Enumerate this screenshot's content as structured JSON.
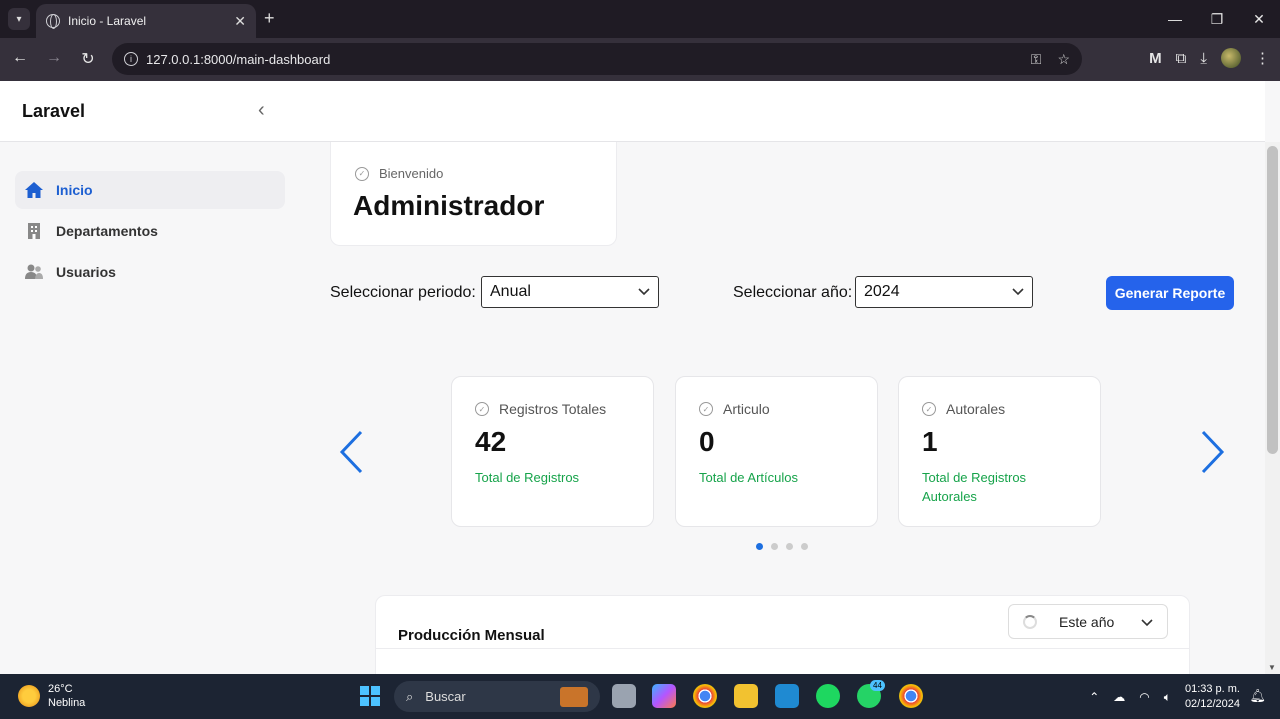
{
  "browser": {
    "tab_title": "Inicio - Laravel",
    "url": "127.0.0.1:8000/main-dashboard"
  },
  "app": {
    "brand": "Laravel",
    "sidebar": {
      "items": [
        {
          "label": "Inicio",
          "icon": "home-icon",
          "active": true
        },
        {
          "label": "Departamentos",
          "icon": "building-icon",
          "active": false
        },
        {
          "label": "Usuarios",
          "icon": "users-icon",
          "active": false
        }
      ]
    },
    "welcome": {
      "label": "Bienvenido",
      "name": "Administrador"
    },
    "filters": {
      "period_label": "Seleccionar periodo:",
      "period_value": "Anual",
      "year_label": "Seleccionar año:",
      "year_value": "2024",
      "report_button": "Generar Reporte"
    },
    "stats": [
      {
        "label": "Registros Totales",
        "value": "42",
        "sub": "Total de Registros"
      },
      {
        "label": "Articulo",
        "value": "0",
        "sub": "Total de Artículos"
      },
      {
        "label": "Autorales",
        "value": "1",
        "sub": "Total de Registros Autorales"
      }
    ],
    "carousel": {
      "pages": 4,
      "active_page": 1
    },
    "production": {
      "title": "Producción Mensual",
      "range": "Este año"
    }
  },
  "taskbar": {
    "temperature": "26°C",
    "condition": "Neblina",
    "search_placeholder": "Buscar",
    "whatsapp_badge": "44",
    "time": "01:33 p. m.",
    "date": "02/12/2024"
  },
  "colors": {
    "accent": "#2563eb",
    "success": "#16a34a",
    "arrow": "#1d6fe0"
  }
}
